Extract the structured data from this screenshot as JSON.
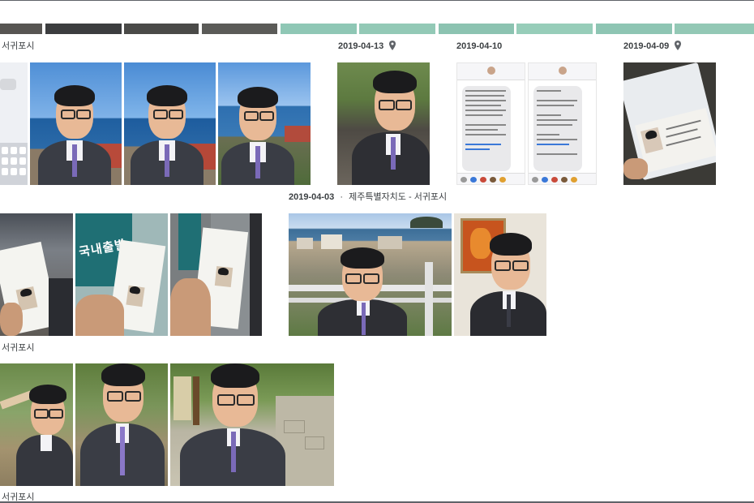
{
  "row1": {
    "groups": [
      {
        "location": "서귀포시"
      },
      {
        "date": "2019-04-13",
        "location_icon": "map-pin-icon"
      },
      {
        "date": "2019-04-10"
      },
      {
        "date": "2019-04-09",
        "location_icon": "map-pin-icon"
      }
    ]
  },
  "row2": {
    "groups": [
      {
        "date": "2019-04-03",
        "separator": "·",
        "location": "제주특별자치도 - 서귀포시"
      }
    ]
  },
  "row3": {
    "groups": [
      {
        "location": "서귀포시"
      }
    ]
  },
  "row4": {
    "groups": [
      {
        "location": "서귀포시"
      }
    ]
  },
  "photos": {
    "sms_screenshot": {
      "text_lines": [
        "국내출발"
      ]
    }
  },
  "colors": {
    "text": "#3c4043",
    "sky": "#4f8fd6",
    "sea": "#1f5fa0",
    "suit": "#3a3d45",
    "tie": "#7a6ab8",
    "boarding_pass": "#f4f4f0",
    "sign_teal": "#1f6f74"
  }
}
